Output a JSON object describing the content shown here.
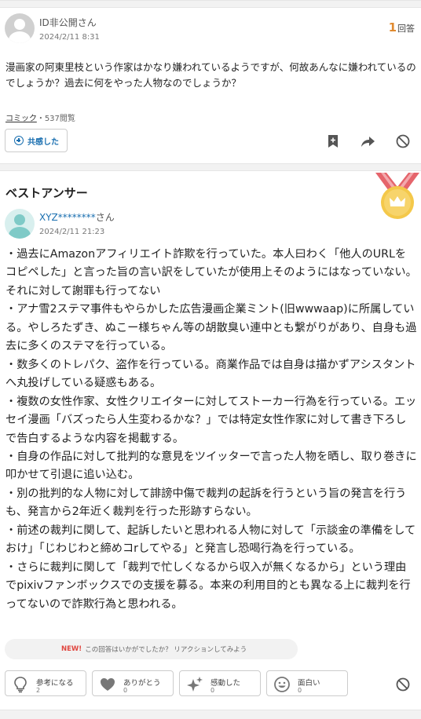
{
  "question": {
    "user": "ID非公開",
    "user_suffix": "さん",
    "date": "2024/2/11 8:31",
    "answer_count": "1",
    "answer_count_label": "回答",
    "body": "漫画家の阿東里枝という作家はかなり嫌われているようですが、何故あんなに嫌われているのでしょうか？過去に何をやった人物なのでしょうか？",
    "category": "コミック",
    "views": "537閲覧",
    "empathy_label": "共感した"
  },
  "best_answer": {
    "title": "ベストアンサー",
    "user": "XYZ********",
    "user_suffix": "さん",
    "date": "2024/2/11 21:23",
    "paragraphs": [
      "・過去にAmazonアフィリエイト詐欺を行っていた。本人曰わく「他人のURLをコピペした」と言った旨の言い訳をしていたが使用上そのようにはなっていない。それに対して謝罪も行ってない",
      "・アナ雪2ステマ事件もやらかした広告漫画企業ミント(旧wwwaap)に所属している。やしろたずき、ぬこー様ちゃん等の胡散臭い連中とも繋がりがあり、自身も過去に多くのステマを行っている。",
      "・数多くのトレパク、盗作を行っている。商業作品では自身は描かずアシスタントへ丸投げしている疑惑もある。",
      "・複数の女性作家、女性クリエイターに対してストーカー行為を行っている。エッセイ漫画「バズったら人生変わるかな？」では特定女性作家に対して書き下ろしで告白するような内容を掲載する。",
      "・自身の作品に対して批判的な意見をツイッターで言った人物を晒し、取り巻きに叩かせて引退に追い込む。",
      "・別の批判的な人物に対して誹謗中傷で裁判の起訴を行うという旨の発言を行うも、発言から2年近く裁判を行った形跡すらない。",
      "・前述の裁判に関して、起訴したいと思われる人物に対して「示談金の準備をしておけ」「じわじわと締めコrしてやる」と発言し恐喝行為を行っている。",
      "・さらに裁判に関して「裁判で忙しくなるから収入が無くなるから」という理由でpixivファンボックスでの支援を募る。本来の利用目的とも異なる上に裁判を行ってないので詐欺行為と思われる。"
    ],
    "feedback_new": "NEW!",
    "feedback_text": "この回答はいかがでしたか？ リアクションしてみよう",
    "reactions": [
      {
        "label": "参考になる",
        "count": "2",
        "icon": "lightbulb-icon"
      },
      {
        "label": "ありがとう",
        "count": "0",
        "icon": "heart-icon"
      },
      {
        "label": "感動した",
        "count": "0",
        "icon": "sparkle-icon"
      },
      {
        "label": "面白い",
        "count": "0",
        "icon": "smile-icon"
      }
    ]
  },
  "colors": {
    "accent_blue": "#1a6fb0",
    "answer_count": "#e08a2f",
    "crown_gold": "#f4c84a",
    "ribbon_pink": "#e5656c",
    "new_badge": "#e0463f"
  }
}
